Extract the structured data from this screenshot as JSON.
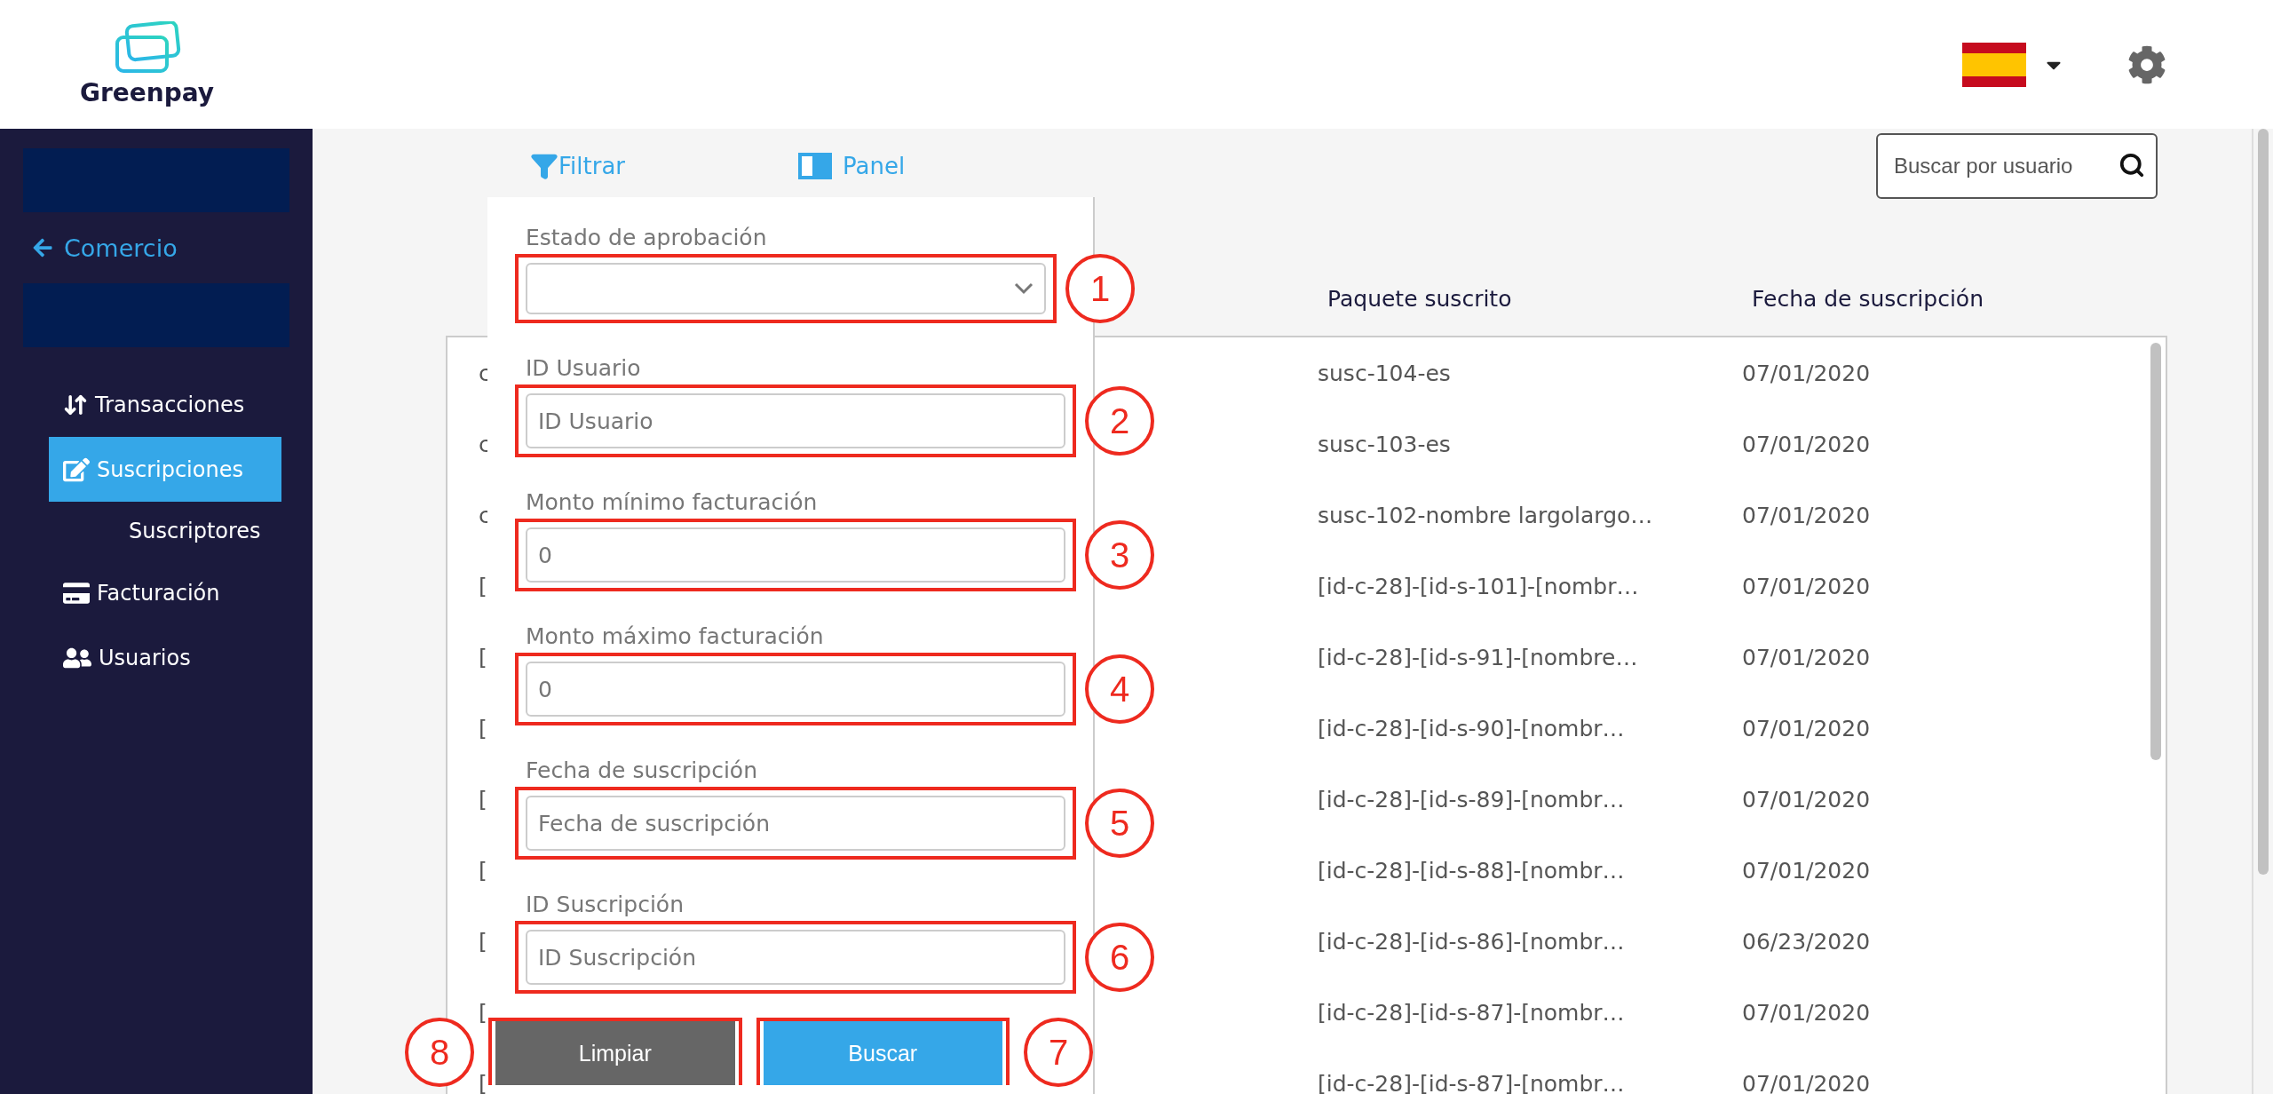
{
  "header": {
    "logo": "Greenpay"
  },
  "sidebar": {
    "back_link": "Comercio",
    "items": [
      {
        "kind": "transfer",
        "label": "Transacciones",
        "selected": false
      },
      {
        "kind": "edit",
        "label": "Suscripciones",
        "selected": true
      },
      {
        "kind": "sub",
        "label": "Suscriptores",
        "selected": false
      },
      {
        "kind": "card",
        "label": "Facturación",
        "selected": false
      },
      {
        "kind": "users",
        "label": "Usuarios",
        "selected": false
      }
    ]
  },
  "toolbar": {
    "filter": "Filtrar",
    "panel": "Panel",
    "search": {
      "placeholder": "Buscar por usuario"
    }
  },
  "table": {
    "columns": [
      "Paquete suscrito",
      "Fecha de suscripción"
    ],
    "rows": [
      {
        "column_1": "c",
        "package": "susc-104-es",
        "date": "07/01/2020"
      },
      {
        "column_1": "c",
        "package": "susc-103-es",
        "date": "07/01/2020"
      },
      {
        "column_1": "c",
        "package": "susc-102-nombre largolargo…",
        "date": "07/01/2020"
      },
      {
        "column_1": "[",
        "package": "[id-c-28]-[id-s-101]-[nombr…",
        "date": "07/01/2020"
      },
      {
        "column_1": "[",
        "package": "[id-c-28]-[id-s-91]-[nombre…",
        "date": "07/01/2020"
      },
      {
        "column_1": "[",
        "package": "[id-c-28]-[id-s-90]-[nombr…",
        "date": "07/01/2020"
      },
      {
        "column_1": "[",
        "package": "[id-c-28]-[id-s-89]-[nombr…",
        "date": "07/01/2020"
      },
      {
        "column_1": "[",
        "package": "[id-c-28]-[id-s-88]-[nombr…",
        "date": "07/01/2020"
      },
      {
        "column_1": "[",
        "package": "[id-c-28]-[id-s-86]-[nombr…",
        "date": "06/23/2020"
      },
      {
        "column_1": "[",
        "package": "[id-c-28]-[id-s-87]-[nombr…",
        "date": "07/01/2020"
      },
      {
        "column_1": "[",
        "package": "[id-c-28]-[id-s-87]-[nombr…",
        "date": "07/01/2020"
      }
    ]
  },
  "filter_panel": {
    "fields": [
      {
        "kind": "select",
        "label": "Estado de aprobación",
        "marker": "1"
      },
      {
        "kind": "input",
        "label": "ID Usuario",
        "placeholder": "ID Usuario",
        "marker": "2"
      },
      {
        "kind": "input",
        "label": "Monto mínimo facturación",
        "value": "0",
        "marker": "3"
      },
      {
        "kind": "input",
        "label": "Monto máximo facturación",
        "value": "0",
        "marker": "4"
      },
      {
        "kind": "input",
        "label": "Fecha de suscripción",
        "placeholder": "Fecha de suscripción",
        "marker": "5"
      },
      {
        "kind": "input",
        "label": "ID Suscripción",
        "placeholder": "ID Suscripción",
        "marker": "6"
      }
    ],
    "buttons": [
      {
        "kind": "clear",
        "label": "Limpiar",
        "marker": "8"
      },
      {
        "kind": "search",
        "label": "Buscar",
        "marker": "7"
      }
    ]
  }
}
